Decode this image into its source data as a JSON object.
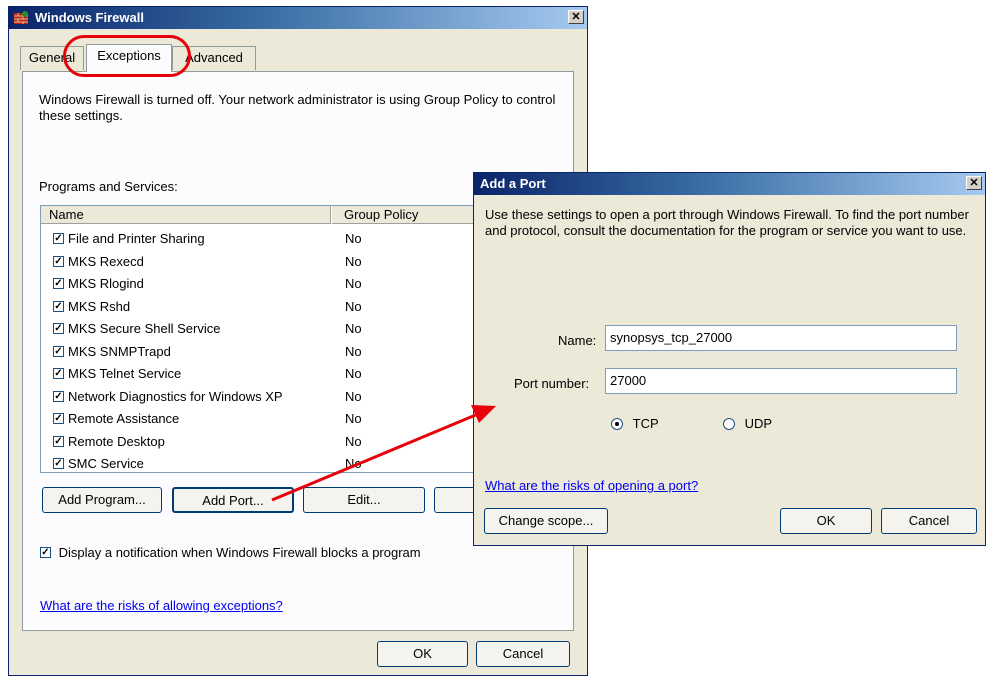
{
  "firewall": {
    "title": "Windows Firewall",
    "tabs": [
      "General",
      "Exceptions",
      "Advanced"
    ],
    "notice": "Windows Firewall is turned off. Your network administrator is using Group Policy to control these settings.",
    "programs_label": "Programs and Services:",
    "columns": [
      "Name",
      "Group Policy"
    ],
    "rows": [
      {
        "name": "File and Printer Sharing",
        "policy": "No"
      },
      {
        "name": "MKS Rexecd",
        "policy": "No"
      },
      {
        "name": "MKS Rlogind",
        "policy": "No"
      },
      {
        "name": "MKS Rshd",
        "policy": "No"
      },
      {
        "name": "MKS Secure Shell Service",
        "policy": "No"
      },
      {
        "name": "MKS SNMPTrapd",
        "policy": "No"
      },
      {
        "name": "MKS Telnet Service",
        "policy": "No"
      },
      {
        "name": "Network Diagnostics for Windows XP",
        "policy": "No"
      },
      {
        "name": "Remote Assistance",
        "policy": "No"
      },
      {
        "name": "Remote Desktop",
        "policy": "No"
      },
      {
        "name": "SMC Service",
        "policy": "No"
      }
    ],
    "buttons": {
      "add_program": "Add Program...",
      "add_port": "Add Port...",
      "edit": "Edit...",
      "ok": "OK",
      "cancel": "Cancel"
    },
    "notify_label": "Display a notification when Windows Firewall blocks a program",
    "risks_link": "What are the risks of allowing exceptions?"
  },
  "add_port": {
    "title": "Add a Port",
    "description": "Use these settings to open a port through Windows Firewall. To find the port number and protocol, consult the documentation for the program or service you want to use.",
    "name_label": "Name:",
    "name_value": "synopsys_tcp_27000",
    "port_label": "Port number:",
    "port_value": "27000",
    "tcp_label": "TCP",
    "udp_label": "UDP",
    "risks_link": "What are the risks of opening a port?",
    "change_scope": "Change scope...",
    "ok": "OK",
    "cancel": "Cancel"
  },
  "colors": {
    "title_dark": "#0a246a",
    "title_light": "#a6caf0",
    "highlight": "#e8000b",
    "link": "#0000ee"
  }
}
